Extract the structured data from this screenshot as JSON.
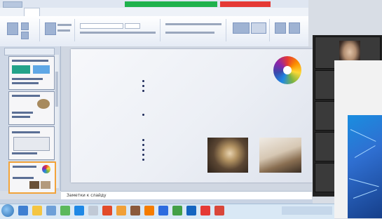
{
  "colors": {
    "ribbon_bg": "#eef2f8",
    "share_green": "#1fb24d",
    "stop_red": "#e53935",
    "slide_text": "#1d2a5a",
    "selection_outline": "#f2a33a"
  },
  "share_banner": {
    "label": "",
    "stop_label": ""
  },
  "slide": {
    "title": "",
    "notes_placeholder": "Заметки к слайду"
  },
  "icons": {
    "color_wheel": "color-wheel-icon",
    "start": "start-icon"
  }
}
